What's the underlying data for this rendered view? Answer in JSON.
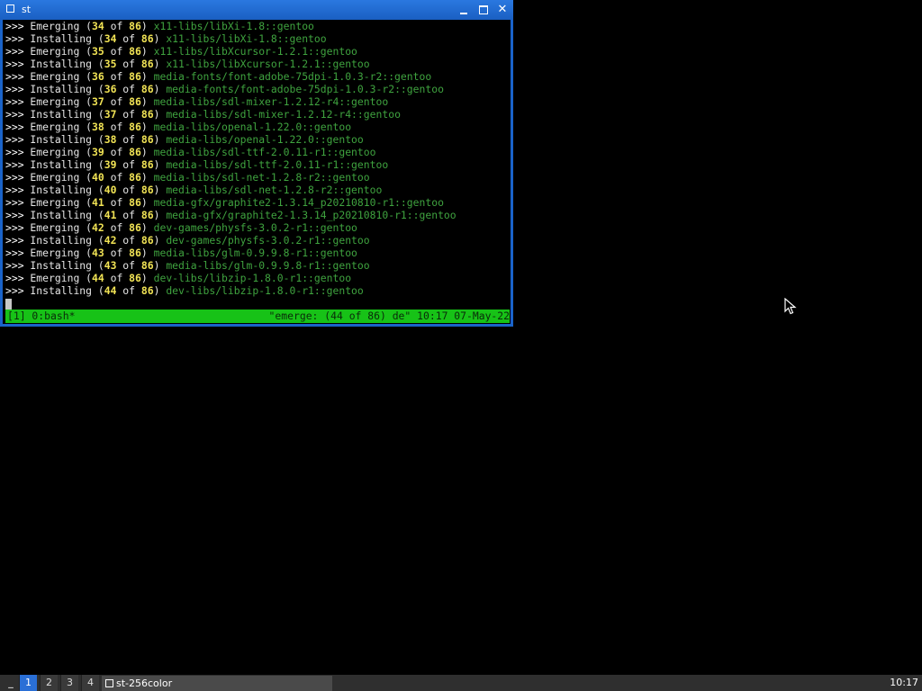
{
  "window": {
    "title": "st",
    "minimize_label": "_",
    "maximize_label": "□",
    "close_label": "✕"
  },
  "terminal": {
    "lines": [
      {
        "arrow": ">>>",
        "verb": " Emerging ",
        "open": "(",
        "cur": "34",
        "of": " of ",
        "total": "86",
        "close": ") ",
        "pkg": "x11-libs/libXi-1.8::gentoo"
      },
      {
        "arrow": ">>>",
        "verb": " Installing ",
        "open": "(",
        "cur": "34",
        "of": " of ",
        "total": "86",
        "close": ") ",
        "pkg": "x11-libs/libXi-1.8::gentoo"
      },
      {
        "arrow": ">>>",
        "verb": " Emerging ",
        "open": "(",
        "cur": "35",
        "of": " of ",
        "total": "86",
        "close": ") ",
        "pkg": "x11-libs/libXcursor-1.2.1::gentoo"
      },
      {
        "arrow": ">>>",
        "verb": " Installing ",
        "open": "(",
        "cur": "35",
        "of": " of ",
        "total": "86",
        "close": ") ",
        "pkg": "x11-libs/libXcursor-1.2.1::gentoo"
      },
      {
        "arrow": ">>>",
        "verb": " Emerging ",
        "open": "(",
        "cur": "36",
        "of": " of ",
        "total": "86",
        "close": ") ",
        "pkg": "media-fonts/font-adobe-75dpi-1.0.3-r2::gentoo"
      },
      {
        "arrow": ">>>",
        "verb": " Installing ",
        "open": "(",
        "cur": "36",
        "of": " of ",
        "total": "86",
        "close": ") ",
        "pkg": "media-fonts/font-adobe-75dpi-1.0.3-r2::gentoo"
      },
      {
        "arrow": ">>>",
        "verb": " Emerging ",
        "open": "(",
        "cur": "37",
        "of": " of ",
        "total": "86",
        "close": ") ",
        "pkg": "media-libs/sdl-mixer-1.2.12-r4::gentoo"
      },
      {
        "arrow": ">>>",
        "verb": " Installing ",
        "open": "(",
        "cur": "37",
        "of": " of ",
        "total": "86",
        "close": ") ",
        "pkg": "media-libs/sdl-mixer-1.2.12-r4::gentoo"
      },
      {
        "arrow": ">>>",
        "verb": " Emerging ",
        "open": "(",
        "cur": "38",
        "of": " of ",
        "total": "86",
        "close": ") ",
        "pkg": "media-libs/openal-1.22.0::gentoo"
      },
      {
        "arrow": ">>>",
        "verb": " Installing ",
        "open": "(",
        "cur": "38",
        "of": " of ",
        "total": "86",
        "close": ") ",
        "pkg": "media-libs/openal-1.22.0::gentoo"
      },
      {
        "arrow": ">>>",
        "verb": " Emerging ",
        "open": "(",
        "cur": "39",
        "of": " of ",
        "total": "86",
        "close": ") ",
        "pkg": "media-libs/sdl-ttf-2.0.11-r1::gentoo"
      },
      {
        "arrow": ">>>",
        "verb": " Installing ",
        "open": "(",
        "cur": "39",
        "of": " of ",
        "total": "86",
        "close": ") ",
        "pkg": "media-libs/sdl-ttf-2.0.11-r1::gentoo"
      },
      {
        "arrow": ">>>",
        "verb": " Emerging ",
        "open": "(",
        "cur": "40",
        "of": " of ",
        "total": "86",
        "close": ") ",
        "pkg": "media-libs/sdl-net-1.2.8-r2::gentoo"
      },
      {
        "arrow": ">>>",
        "verb": " Installing ",
        "open": "(",
        "cur": "40",
        "of": " of ",
        "total": "86",
        "close": ") ",
        "pkg": "media-libs/sdl-net-1.2.8-r2::gentoo"
      },
      {
        "arrow": ">>>",
        "verb": " Emerging ",
        "open": "(",
        "cur": "41",
        "of": " of ",
        "total": "86",
        "close": ") ",
        "pkg": "media-gfx/graphite2-1.3.14_p20210810-r1::gentoo"
      },
      {
        "arrow": ">>>",
        "verb": " Installing ",
        "open": "(",
        "cur": "41",
        "of": " of ",
        "total": "86",
        "close": ") ",
        "pkg": "media-gfx/graphite2-1.3.14_p20210810-r1::gentoo"
      },
      {
        "arrow": ">>>",
        "verb": " Emerging ",
        "open": "(",
        "cur": "42",
        "of": " of ",
        "total": "86",
        "close": ") ",
        "pkg": "dev-games/physfs-3.0.2-r1::gentoo"
      },
      {
        "arrow": ">>>",
        "verb": " Installing ",
        "open": "(",
        "cur": "42",
        "of": " of ",
        "total": "86",
        "close": ") ",
        "pkg": "dev-games/physfs-3.0.2-r1::gentoo"
      },
      {
        "arrow": ">>>",
        "verb": " Emerging ",
        "open": "(",
        "cur": "43",
        "of": " of ",
        "total": "86",
        "close": ") ",
        "pkg": "media-libs/glm-0.9.9.8-r1::gentoo"
      },
      {
        "arrow": ">>>",
        "verb": " Installing ",
        "open": "(",
        "cur": "43",
        "of": " of ",
        "total": "86",
        "close": ") ",
        "pkg": "media-libs/glm-0.9.9.8-r1::gentoo"
      },
      {
        "arrow": ">>>",
        "verb": " Emerging ",
        "open": "(",
        "cur": "44",
        "of": " of ",
        "total": "86",
        "close": ") ",
        "pkg": "dev-libs/libzip-1.8.0-r1::gentoo"
      },
      {
        "arrow": ">>>",
        "verb": " Installing ",
        "open": "(",
        "cur": "44",
        "of": " of ",
        "total": "86",
        "close": ") ",
        "pkg": "dev-libs/libzip-1.8.0-r1::gentoo"
      }
    ],
    "status_left": "[1] 0:bash*",
    "status_right": "\"emerge: (44 of 86) de\" 10:17 07-May-22"
  },
  "taskbar": {
    "menu_label": "_",
    "workspaces": [
      "1",
      "2",
      "3",
      "4"
    ],
    "active_workspace": "1",
    "task_label": "st-256color",
    "clock": "10:17"
  },
  "colors": {
    "titlebar": "#1a63c9",
    "package_text": "#3fa33f",
    "number_text": "#f2e455",
    "statusbar": "#17c217",
    "active_workspace": "#2a6fd6"
  }
}
